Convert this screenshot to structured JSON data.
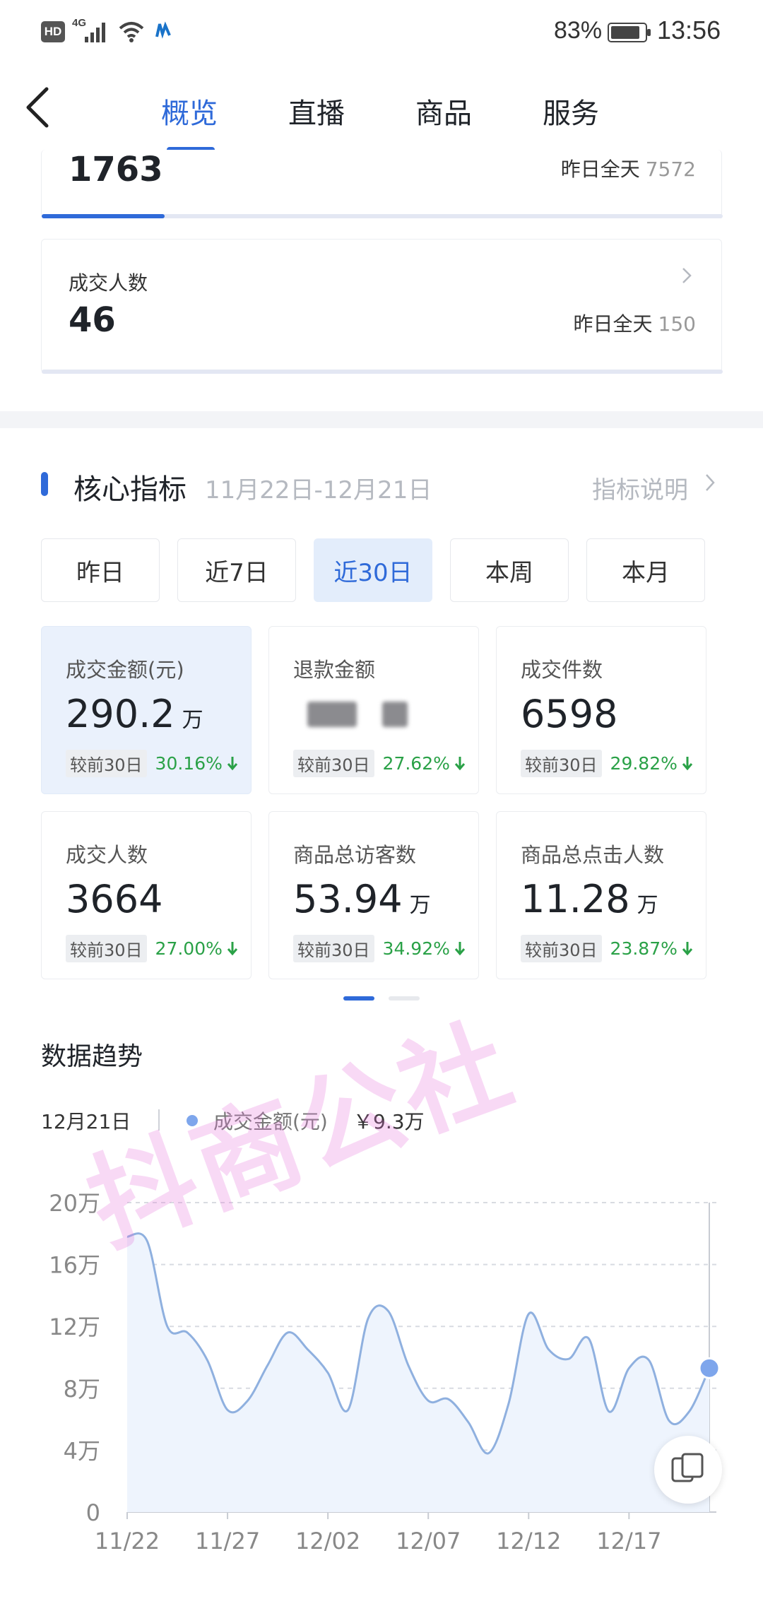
{
  "status_bar": {
    "hd": "HD",
    "signal_label": "4G",
    "battery_pct": "83%",
    "time": "13:56"
  },
  "nav": {
    "tabs": [
      {
        "label": "概览",
        "active": true
      },
      {
        "label": "直播",
        "active": false
      },
      {
        "label": "商品",
        "active": false
      },
      {
        "label": "服务",
        "active": false
      }
    ]
  },
  "summary_cards": [
    {
      "label": "",
      "value": "1763",
      "yesterday_label": "昨日全天",
      "yesterday_value": "7572",
      "progress": 0.18
    },
    {
      "label": "成交人数",
      "value": "46",
      "yesterday_label": "昨日全天",
      "yesterday_value": "150"
    }
  ],
  "core": {
    "title": "核心指标",
    "date_range": "11月22日-12月21日",
    "help_label": "指标说明",
    "periods": [
      {
        "label": "昨日",
        "active": false
      },
      {
        "label": "近7日",
        "active": false
      },
      {
        "label": "近30日",
        "active": true
      },
      {
        "label": "本周",
        "active": false
      },
      {
        "label": "本月",
        "active": false
      }
    ],
    "metrics": [
      {
        "label": "成交金额(元)",
        "value": "290.2",
        "unit": "万",
        "compare_label": "较前30日",
        "change": "30.16%",
        "selected": true,
        "blurred": false
      },
      {
        "label": "退款金额",
        "value": "",
        "unit": "",
        "compare_label": "较前30日",
        "change": "27.62%",
        "selected": false,
        "blurred": true
      },
      {
        "label": "成交件数",
        "value": "6598",
        "unit": "",
        "compare_label": "较前30日",
        "change": "29.82%",
        "selected": false,
        "blurred": false
      },
      {
        "label": "成交人数",
        "value": "3664",
        "unit": "",
        "compare_label": "较前30日",
        "change": "27.00%",
        "selected": false,
        "blurred": false
      },
      {
        "label": "商品总访客数",
        "value": "53.94",
        "unit": "万",
        "compare_label": "较前30日",
        "change": "34.92%",
        "selected": false,
        "blurred": false
      },
      {
        "label": "商品总点击人数",
        "value": "11.28",
        "unit": "万",
        "compare_label": "较前30日",
        "change": "23.87%",
        "selected": false,
        "blurred": false
      }
    ],
    "page_indicator": {
      "current": 1,
      "total": 2
    }
  },
  "trend": {
    "title": "数据趋势",
    "selected_date": "12月21日",
    "series_label": "成交金额(元)",
    "selected_value": "￥9.3万"
  },
  "watermark": "抖商公社",
  "chart_data": {
    "type": "area",
    "title": "",
    "series": [
      {
        "name": "成交金额(元)",
        "values": [
          17.8,
          17.5,
          12.0,
          11.6,
          9.8,
          6.6,
          7.2,
          9.5,
          11.6,
          10.5,
          9.0,
          6.6,
          12.5,
          13.0,
          9.5,
          7.2,
          7.3,
          5.8,
          3.8,
          7.0,
          12.8,
          10.5,
          9.9,
          11.2,
          6.5,
          9.3,
          9.8,
          5.9,
          6.5,
          9.3
        ]
      },
      {
        "name": "",
        "values": []
      }
    ],
    "x": [
      "11/22",
      "11/23",
      "11/24",
      "11/25",
      "11/26",
      "11/27",
      "11/28",
      "11/29",
      "11/30",
      "12/01",
      "12/02",
      "12/03",
      "12/04",
      "12/05",
      "12/06",
      "12/07",
      "12/08",
      "12/09",
      "12/10",
      "12/11",
      "12/12",
      "12/13",
      "12/14",
      "12/15",
      "12/16",
      "12/17",
      "12/18",
      "12/19",
      "12/20",
      "12/21"
    ],
    "x_tick_labels": [
      "11/22",
      "11/27",
      "12/02",
      "12/07",
      "12/12",
      "12/17"
    ],
    "y_tick_labels": [
      "0",
      "4万",
      "8万",
      "12万",
      "16万",
      "20万"
    ],
    "ylim": [
      0,
      20
    ],
    "y_unit": "万",
    "grid": true,
    "colors": {
      "line": "#8fb0df",
      "fill": "#eef4fd",
      "marker": "#7ea6ec",
      "grid": "#d8dbe1"
    }
  }
}
